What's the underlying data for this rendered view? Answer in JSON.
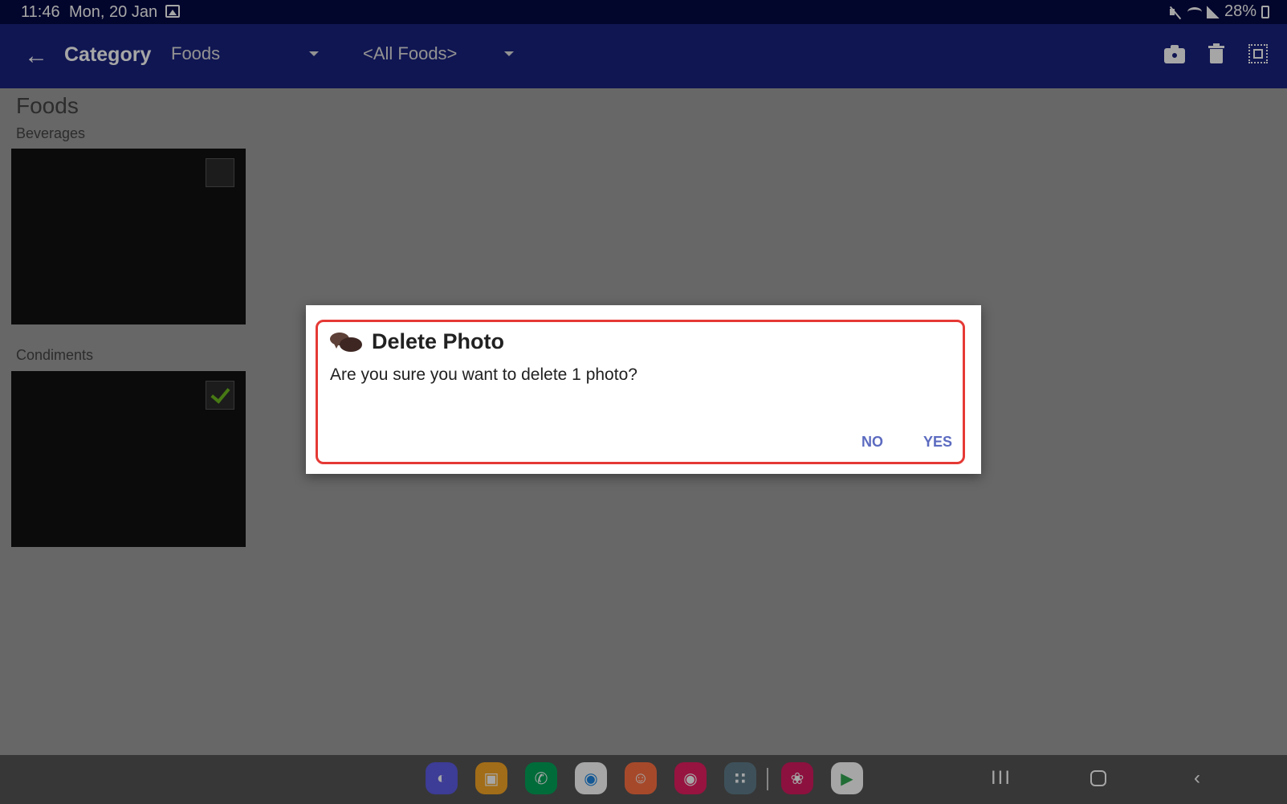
{
  "status_bar": {
    "time": "11:46",
    "date": "Mon, 20 Jan",
    "battery": "28%"
  },
  "app_bar": {
    "back_icon": "arrow-left",
    "title": "Category",
    "category_dropdown": "Foods",
    "filter_dropdown": "<All Foods>",
    "actions": [
      "camera-icon",
      "trash-icon",
      "select-all-icon"
    ]
  },
  "content": {
    "group_title": "Foods",
    "sections": [
      {
        "label": "Beverages",
        "checked": false
      },
      {
        "label": "Condiments",
        "checked": true
      }
    ]
  },
  "dialog": {
    "icon": "chat-bubbles-icon",
    "title": "Delete Photo",
    "message": "Are you sure you want to delete 1 photo?",
    "no_label": "NO",
    "yes_label": "YES",
    "highlight_color": "#e53935",
    "button_color": "#5c6bc0"
  },
  "taskbar": {
    "apps": [
      {
        "name": "internet",
        "color": "#5e5ce6"
      },
      {
        "name": "my-files",
        "color": "#f9a825"
      },
      {
        "name": "phone",
        "color": "#00a65a"
      },
      {
        "name": "messages",
        "color": "#1e88e5"
      },
      {
        "name": "contacts",
        "color": "#ff7043"
      },
      {
        "name": "screen-recorder",
        "color": "#e91e63"
      },
      {
        "name": "app-drawer",
        "color": "#607d8b"
      },
      {
        "name": "blossom",
        "color": "#d81b60"
      },
      {
        "name": "play-store",
        "color": "#ffffff"
      }
    ]
  }
}
